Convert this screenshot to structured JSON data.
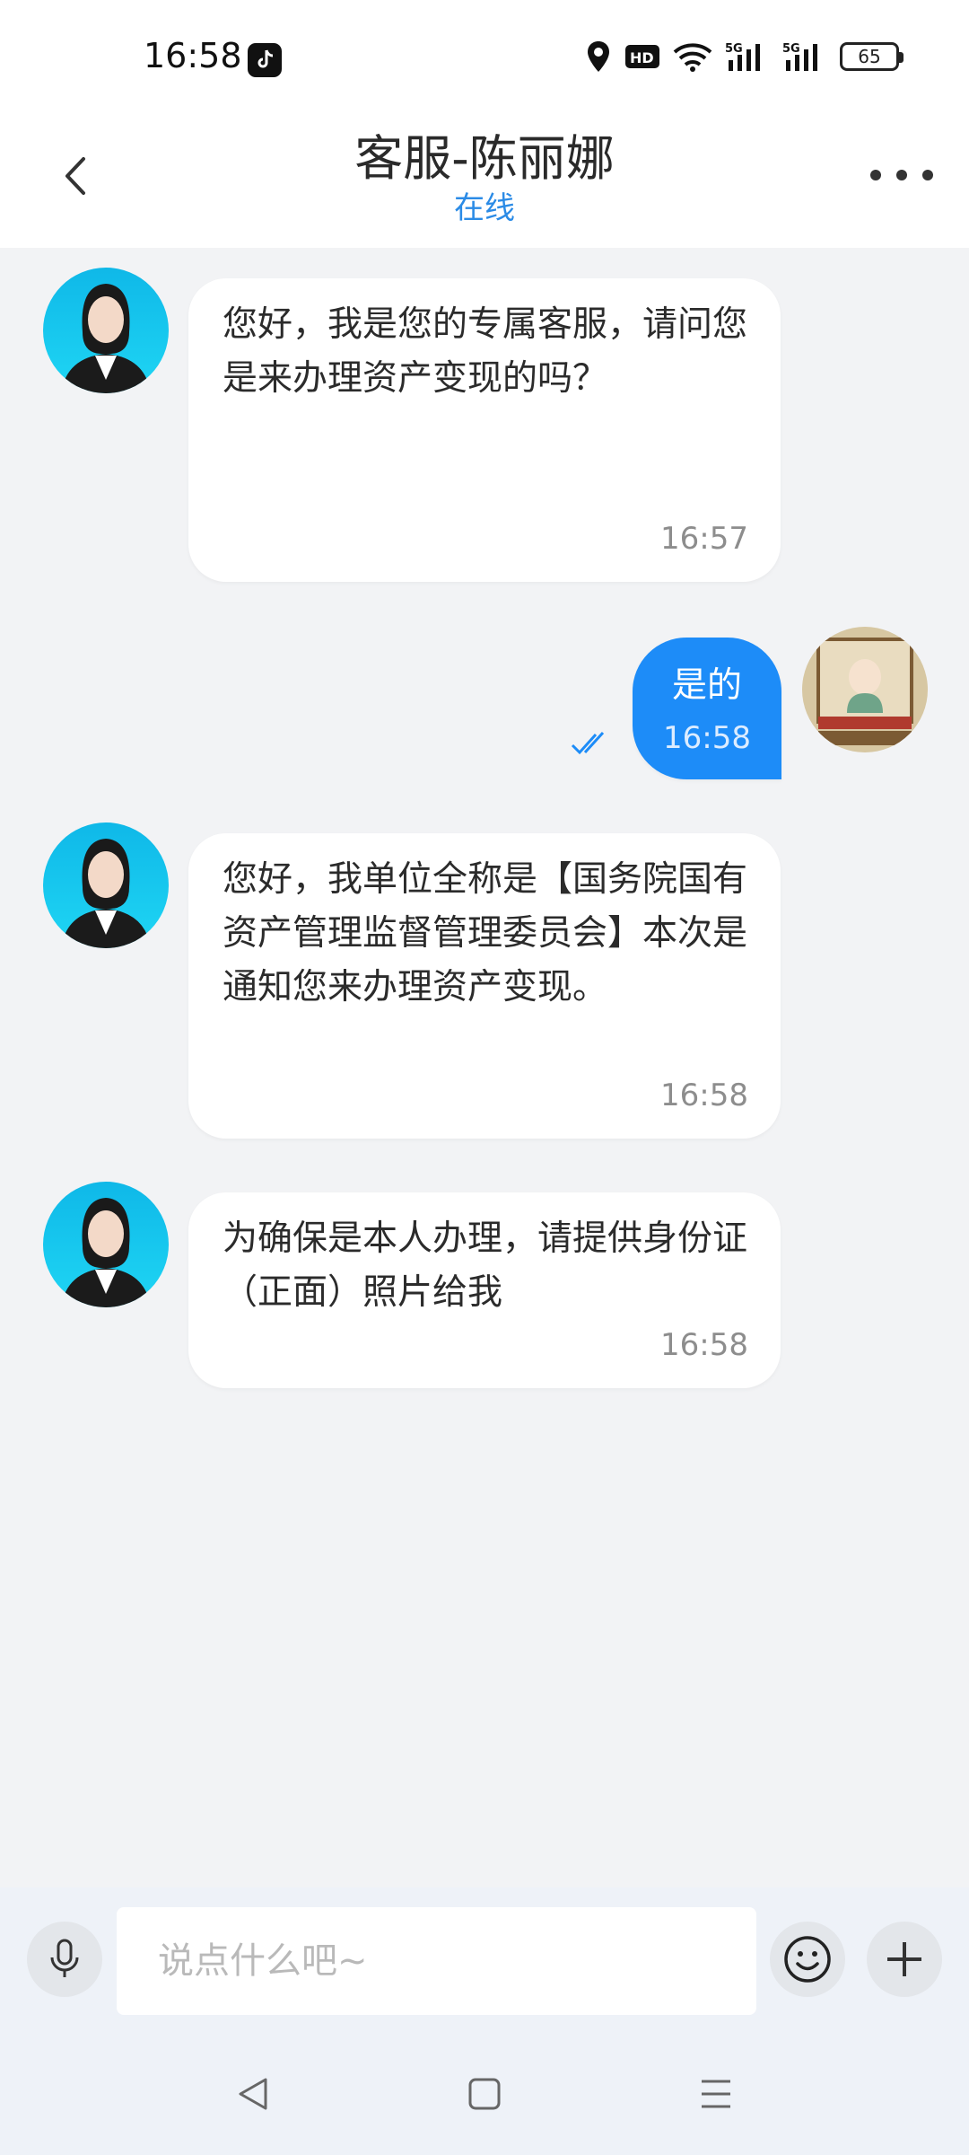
{
  "status_bar": {
    "time": "16:58",
    "network": "5G",
    "network2": "5G",
    "battery": "65"
  },
  "header": {
    "title": "客服-陈丽娜",
    "status": "在线"
  },
  "messages": [
    {
      "text": "您好，我是您的专属客服，请问您是来办理资产变现的吗？",
      "time": "16:57",
      "from": "agent"
    },
    {
      "text": "是的",
      "time": "16:58",
      "from": "me"
    },
    {
      "text": "您好，我单位全称是【国务院国有资产管理监督管理委员会】本次是通知您来办理资产变现。",
      "time": "16:58",
      "from": "agent"
    },
    {
      "text": "为确保是本人办理，请提供身份证（正面）照片给我",
      "time": "16:58",
      "from": "agent"
    }
  ],
  "input": {
    "placeholder": "说点什么吧~"
  },
  "colors": {
    "accent": "#1d8cf8",
    "online": "#2b8be6",
    "background": "#f2f3f5"
  },
  "icons": [
    "back-icon",
    "more-icon",
    "mic-icon",
    "emoji-icon",
    "plus-icon",
    "nav-back-icon",
    "nav-home-icon",
    "nav-menu-icon",
    "read-check-icon"
  ]
}
